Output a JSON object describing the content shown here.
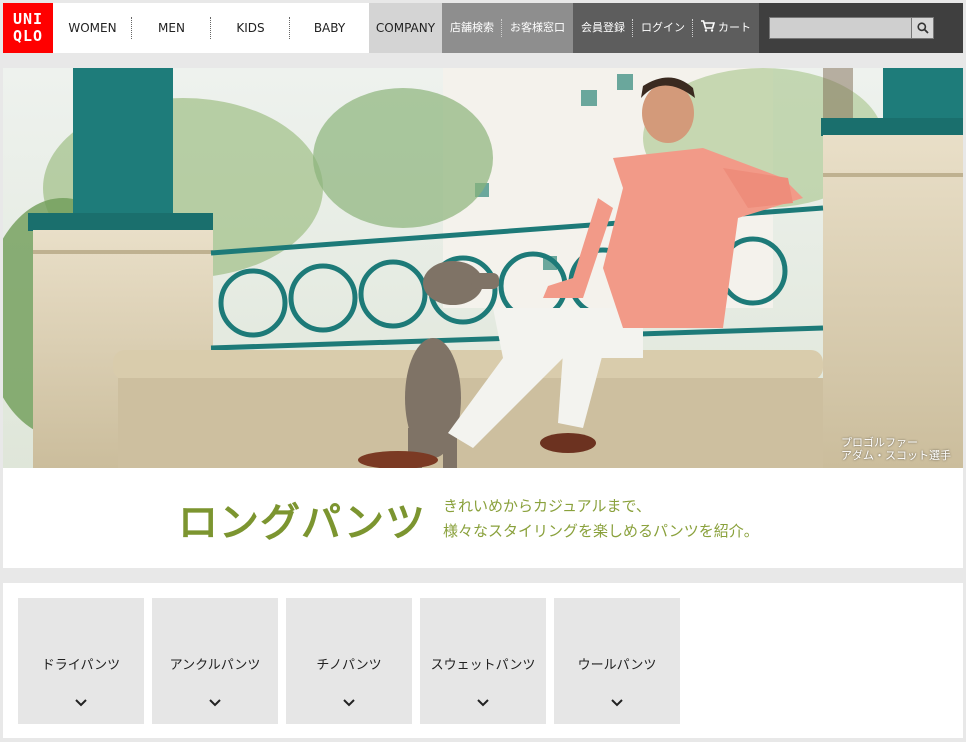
{
  "header": {
    "logo_top": "UNI",
    "logo_bottom": "QLO",
    "nav": [
      "WOMEN",
      "MEN",
      "KIDS",
      "BABY"
    ],
    "company": "COMPANY",
    "util_light": [
      "店舗検索",
      "お客様窓口"
    ],
    "util_dark": [
      "会員登録",
      "ログイン"
    ],
    "cart": "カート",
    "search_placeholder": ""
  },
  "hero": {
    "caption_line1": "プロゴルファー",
    "caption_line2": "アダム・スコット選手"
  },
  "title_band": {
    "title": "ロングパンツ",
    "desc_line1": "きれいめからカジュアルまで、",
    "desc_line2": "様々なスタイリングを楽しめるパンツを紹介。"
  },
  "categories": [
    {
      "label": "ドライパンツ"
    },
    {
      "label": "アンクルパンツ"
    },
    {
      "label": "チノパンツ"
    },
    {
      "label": "スウェットパンツ"
    },
    {
      "label": "ウールパンツ"
    }
  ],
  "colors": {
    "brand_red": "#ff0000",
    "title_green": "#7c9530",
    "railing_teal": "#1d7a78"
  },
  "icons": [
    "cart-icon",
    "search-icon",
    "chevron-down-icon"
  ]
}
